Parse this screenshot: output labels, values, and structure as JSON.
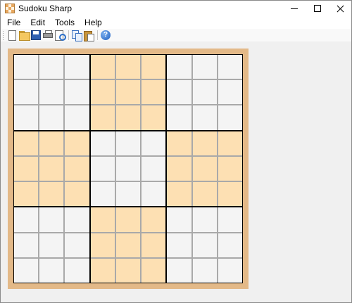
{
  "window": {
    "title": "Sudoku Sharp"
  },
  "menu": [
    "File",
    "Edit",
    "Tools",
    "Help"
  ],
  "toolbar": {
    "buttons": [
      {
        "icon": "new-document-icon"
      },
      {
        "icon": "open-folder-icon"
      },
      {
        "icon": "save-icon"
      },
      {
        "icon": "print-icon"
      },
      {
        "icon": "print-preview-icon"
      },
      {
        "icon": "copy-icon"
      },
      {
        "icon": "paste-icon"
      },
      {
        "icon": "help-icon"
      }
    ]
  },
  "board": {
    "size": 9,
    "colors": {
      "frame": "#e3b988",
      "cell_light": "#f4f4f4",
      "cell_shaded": "#fde0b3",
      "thin_lines": "#a9a9a9",
      "box_lines": "#000000"
    },
    "shaded_boxes": [
      1,
      3,
      5,
      7
    ],
    "cells": [
      [
        "",
        "",
        "",
        "",
        "",
        "",
        "",
        "",
        ""
      ],
      [
        "",
        "",
        "",
        "",
        "",
        "",
        "",
        "",
        ""
      ],
      [
        "",
        "",
        "",
        "",
        "",
        "",
        "",
        "",
        ""
      ],
      [
        "",
        "",
        "",
        "",
        "",
        "",
        "",
        "",
        ""
      ],
      [
        "",
        "",
        "",
        "",
        "",
        "",
        "",
        "",
        ""
      ],
      [
        "",
        "",
        "",
        "",
        "",
        "",
        "",
        "",
        ""
      ],
      [
        "",
        "",
        "",
        "",
        "",
        "",
        "",
        "",
        ""
      ],
      [
        "",
        "",
        "",
        "",
        "",
        "",
        "",
        "",
        ""
      ],
      [
        "",
        "",
        "",
        "",
        "",
        "",
        "",
        "",
        ""
      ]
    ]
  }
}
